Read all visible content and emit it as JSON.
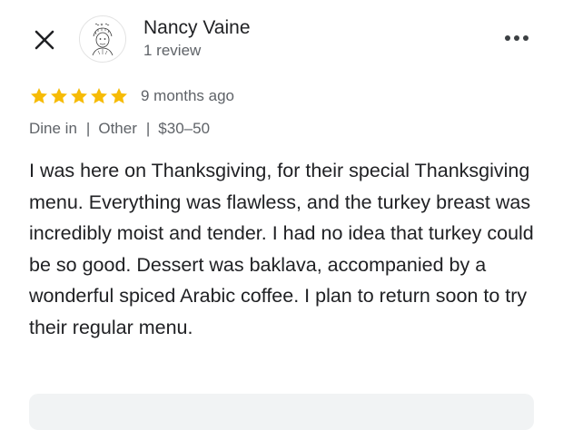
{
  "review": {
    "author": {
      "name": "Nancy Vaine",
      "meta": "1 review",
      "avatar_icon": "sketch-portrait-avatar"
    },
    "rating": 5,
    "rating_max": 5,
    "date": "9 months ago",
    "tags": [
      "Dine in",
      "Other",
      "$30–50"
    ],
    "text": "I was here on Thanksgiving, for their special Thanksgiving menu. Everything was flawless, and the turkey breast was incredibly moist and tender. I had no idea that turkey could be so good. Dessert was baklava, accompanied by a wonderful spiced Arabic coffee. I plan to return soon to try their regular menu."
  },
  "icons": {
    "close": "close-icon",
    "more": "more-options-icon",
    "star": "star-icon"
  },
  "colors": {
    "star": "#f6bb06",
    "text_primary": "#202124",
    "text_secondary": "#5f6368",
    "owner_response_bg": "#f1f3f4"
  }
}
